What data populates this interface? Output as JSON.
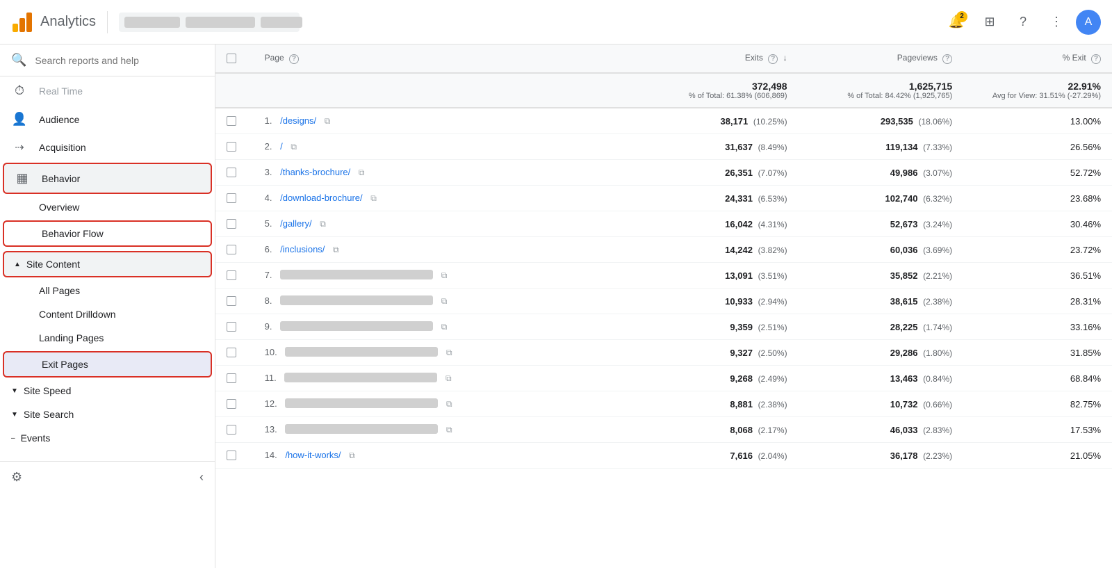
{
  "header": {
    "title": "Analytics",
    "notification_count": "2",
    "search_placeholder": "Search reports and help"
  },
  "sidebar": {
    "search_placeholder": "Search reports and help",
    "items": [
      {
        "id": "realtime",
        "label": "Real Time",
        "icon": "⏱"
      },
      {
        "id": "audience",
        "label": "Audience",
        "icon": "👤"
      },
      {
        "id": "acquisition",
        "label": "Acquisition",
        "icon": "🎯"
      },
      {
        "id": "behavior",
        "label": "Behavior",
        "icon": "📋"
      }
    ],
    "behavior_sub": [
      {
        "id": "overview",
        "label": "Overview"
      },
      {
        "id": "behavior-flow",
        "label": "Behavior Flow"
      }
    ],
    "site_content_label": "Site Content",
    "site_content_sub": [
      {
        "id": "all-pages",
        "label": "All Pages"
      },
      {
        "id": "content-drilldown",
        "label": "Content Drilldown"
      },
      {
        "id": "landing-pages",
        "label": "Landing Pages"
      },
      {
        "id": "exit-pages",
        "label": "Exit Pages"
      }
    ],
    "site_speed_label": "Site Speed",
    "site_search_label": "Site Search",
    "events_label": "Events"
  },
  "table": {
    "columns": [
      {
        "id": "page",
        "label": "Page",
        "has_help": true
      },
      {
        "id": "exits",
        "label": "Exits",
        "has_help": true,
        "sorted": true
      },
      {
        "id": "pageviews",
        "label": "Pageviews",
        "has_help": true
      },
      {
        "id": "exit_pct",
        "label": "% Exit",
        "has_help": true
      }
    ],
    "totals": {
      "exits": "372,498",
      "exits_pct": "% of Total: 61.38% (606,869)",
      "pageviews": "1,625,715",
      "pageviews_pct": "% of Total: 84.42% (1,925,765)",
      "exit_pct": "22.91%",
      "exit_pct_sub": "Avg for View: 31.51% (-27.29%)"
    },
    "rows": [
      {
        "num": "1.",
        "page": "/designs/",
        "exits": "38,171",
        "exits_pct": "(10.25%)",
        "pageviews": "293,535",
        "pageviews_pct": "(18.06%)",
        "exit_pct": "13.00%",
        "blurred": false
      },
      {
        "num": "2.",
        "page": "/",
        "exits": "31,637",
        "exits_pct": "(8.49%)",
        "pageviews": "119,134",
        "pageviews_pct": "(7.33%)",
        "exit_pct": "26.56%",
        "blurred": false
      },
      {
        "num": "3.",
        "page": "/thanks-brochure/",
        "exits": "26,351",
        "exits_pct": "(7.07%)",
        "pageviews": "49,986",
        "pageviews_pct": "(3.07%)",
        "exit_pct": "52.72%",
        "blurred": false
      },
      {
        "num": "4.",
        "page": "/download-brochure/",
        "exits": "24,331",
        "exits_pct": "(6.53%)",
        "pageviews": "102,740",
        "pageviews_pct": "(6.32%)",
        "exit_pct": "23.68%",
        "blurred": false
      },
      {
        "num": "5.",
        "page": "/gallery/",
        "exits": "16,042",
        "exits_pct": "(4.31%)",
        "pageviews": "52,673",
        "pageviews_pct": "(3.24%)",
        "exit_pct": "30.46%",
        "blurred": false
      },
      {
        "num": "6.",
        "page": "/inclusions/",
        "exits": "14,242",
        "exits_pct": "(3.82%)",
        "pageviews": "60,036",
        "pageviews_pct": "(3.69%)",
        "exit_pct": "23.72%",
        "blurred": false
      },
      {
        "num": "7.",
        "page": "BLURRED_PAGE_7",
        "exits": "13,091",
        "exits_pct": "(3.51%)",
        "pageviews": "35,852",
        "pageviews_pct": "(2.21%)",
        "exit_pct": "36.51%",
        "blurred": true
      },
      {
        "num": "8.",
        "page": "BLURRED_PAGE_8",
        "exits": "10,933",
        "exits_pct": "(2.94%)",
        "pageviews": "38,615",
        "pageviews_pct": "(2.38%)",
        "exit_pct": "28.31%",
        "blurred": true
      },
      {
        "num": "9.",
        "page": "BLURRED_PAGE_9",
        "exits": "9,359",
        "exits_pct": "(2.51%)",
        "pageviews": "28,225",
        "pageviews_pct": "(1.74%)",
        "exit_pct": "33.16%",
        "blurred": true
      },
      {
        "num": "10.",
        "page": "BLURRED_PAGE_10",
        "exits": "9,327",
        "exits_pct": "(2.50%)",
        "pageviews": "29,286",
        "pageviews_pct": "(1.80%)",
        "exit_pct": "31.85%",
        "blurred": true
      },
      {
        "num": "11.",
        "page": "BLURRED_PAGE_11",
        "exits": "9,268",
        "exits_pct": "(2.49%)",
        "pageviews": "13,463",
        "pageviews_pct": "(0.84%)",
        "exit_pct": "68.84%",
        "blurred": true
      },
      {
        "num": "12.",
        "page": "BLURRED_PAGE_12",
        "exits": "8,881",
        "exits_pct": "(2.38%)",
        "pageviews": "10,732",
        "pageviews_pct": "(0.66%)",
        "exit_pct": "82.75%",
        "blurred": true
      },
      {
        "num": "13.",
        "page": "BLURRED_PAGE_13",
        "exits": "8,068",
        "exits_pct": "(2.17%)",
        "pageviews": "46,033",
        "pageviews_pct": "(2.83%)",
        "exit_pct": "17.53%",
        "blurred": true
      },
      {
        "num": "14.",
        "page": "/how-it-works/",
        "exits": "7,616",
        "exits_pct": "(2.04%)",
        "pageviews": "36,178",
        "pageviews_pct": "(2.23%)",
        "exit_pct": "21.05%",
        "blurred": false
      }
    ]
  }
}
